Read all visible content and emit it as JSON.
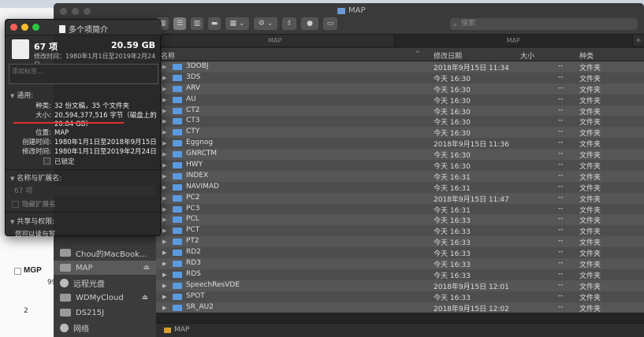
{
  "finder": {
    "window_title": "MAP",
    "search_placeholder": "搜索",
    "tabs": [
      "MAP",
      "MAP"
    ],
    "tab_add": "+",
    "columns": {
      "name": "名称",
      "date": "修改日期",
      "size": "大小",
      "kind": "种类"
    },
    "sort_indicator": "^",
    "sidebar": [
      {
        "label": "Chou的MacBook...",
        "icon": "laptop-icon",
        "eject": false,
        "active": false
      },
      {
        "label": "MAP",
        "icon": "drive-icon",
        "eject": true,
        "active": true
      },
      {
        "label": "远程光盘",
        "icon": "disc-icon",
        "eject": false,
        "active": false
      },
      {
        "label": "WDMyCloud",
        "icon": "monitor-icon",
        "eject": true,
        "active": false
      },
      {
        "label": "DS215J",
        "icon": "nas-icon",
        "eject": false,
        "active": false
      },
      {
        "label": "网络",
        "icon": "globe-icon",
        "eject": false,
        "active": false
      }
    ],
    "rows": [
      {
        "name": "3DOBJ",
        "date": "2018年9月15日 11:34",
        "size": "--",
        "kind": "文件夹"
      },
      {
        "name": "3DS",
        "date": "今天 16:30",
        "size": "--",
        "kind": "文件夹"
      },
      {
        "name": "ARV",
        "date": "今天 16:30",
        "size": "--",
        "kind": "文件夹"
      },
      {
        "name": "AU",
        "date": "今天 16:30",
        "size": "--",
        "kind": "文件夹"
      },
      {
        "name": "CT2",
        "date": "今天 16:30",
        "size": "--",
        "kind": "文件夹"
      },
      {
        "name": "CT3",
        "date": "今天 16:30",
        "size": "--",
        "kind": "文件夹"
      },
      {
        "name": "CTY",
        "date": "今天 16:30",
        "size": "--",
        "kind": "文件夹"
      },
      {
        "name": "Eggnog",
        "date": "2018年9月15日 11:36",
        "size": "--",
        "kind": "文件夹"
      },
      {
        "name": "GNRCTM",
        "date": "今天 16:30",
        "size": "--",
        "kind": "文件夹"
      },
      {
        "name": "HWY",
        "date": "今天 16:30",
        "size": "--",
        "kind": "文件夹"
      },
      {
        "name": "INDEX",
        "date": "今天 16:31",
        "size": "--",
        "kind": "文件夹"
      },
      {
        "name": "NAVIMAD",
        "date": "今天 16:31",
        "size": "--",
        "kind": "文件夹"
      },
      {
        "name": "PC2",
        "date": "2018年9月15日 11:47",
        "size": "--",
        "kind": "文件夹"
      },
      {
        "name": "PC3",
        "date": "今天 16:31",
        "size": "--",
        "kind": "文件夹"
      },
      {
        "name": "PCL",
        "date": "今天 16:33",
        "size": "--",
        "kind": "文件夹"
      },
      {
        "name": "PCT",
        "date": "今天 16:33",
        "size": "--",
        "kind": "文件夹"
      },
      {
        "name": "PT2",
        "date": "今天 16:33",
        "size": "--",
        "kind": "文件夹"
      },
      {
        "name": "RD2",
        "date": "今天 16:33",
        "size": "--",
        "kind": "文件夹"
      },
      {
        "name": "RD3",
        "date": "今天 16:33",
        "size": "--",
        "kind": "文件夹"
      },
      {
        "name": "RDS",
        "date": "今天 16:33",
        "size": "--",
        "kind": "文件夹"
      },
      {
        "name": "SpeechResVDE",
        "date": "2018年9月15日 12:01",
        "size": "--",
        "kind": "文件夹"
      },
      {
        "name": "SPOT",
        "date": "今天 16:33",
        "size": "--",
        "kind": "文件夹"
      },
      {
        "name": "SR_AU2",
        "date": "2018年9月15日 12:02",
        "size": "--",
        "kind": "文件夹"
      }
    ],
    "path_bar": "MAP"
  },
  "info": {
    "title": "多个项简介",
    "count": "67 项",
    "total_size": "20.59 GB",
    "modified_summary": "修改时间：1980年1月1日至2019年2月24日",
    "tags_placeholder": "添加标签...",
    "general_header": "通用:",
    "kind_key": "种类:",
    "kind_val": "32 份文稿，35 个文件夹",
    "size_key": "大小:",
    "size_val": "20,594,377,516 字节（磁盘上的",
    "size_val2": "20.84 GB）",
    "where_key": "位置:",
    "where_val": "MAP",
    "created_key": "创建时间:",
    "created_val": "1980年1月1日至2018年9月15日",
    "modified_key": "修改时间:",
    "modified_val": "1980年1月1日至2019年2月24日",
    "locked_label": "已锁定",
    "name_ext_header": "名称与扩展名:",
    "name_field_value": "67 项",
    "hide_ext_label": "隐藏扩展名",
    "sharing_header": "共享与权限:",
    "permission_text": "您可以读与写"
  },
  "background": {
    "mgp": "MGP",
    "n99": "99",
    "n2": "2"
  }
}
